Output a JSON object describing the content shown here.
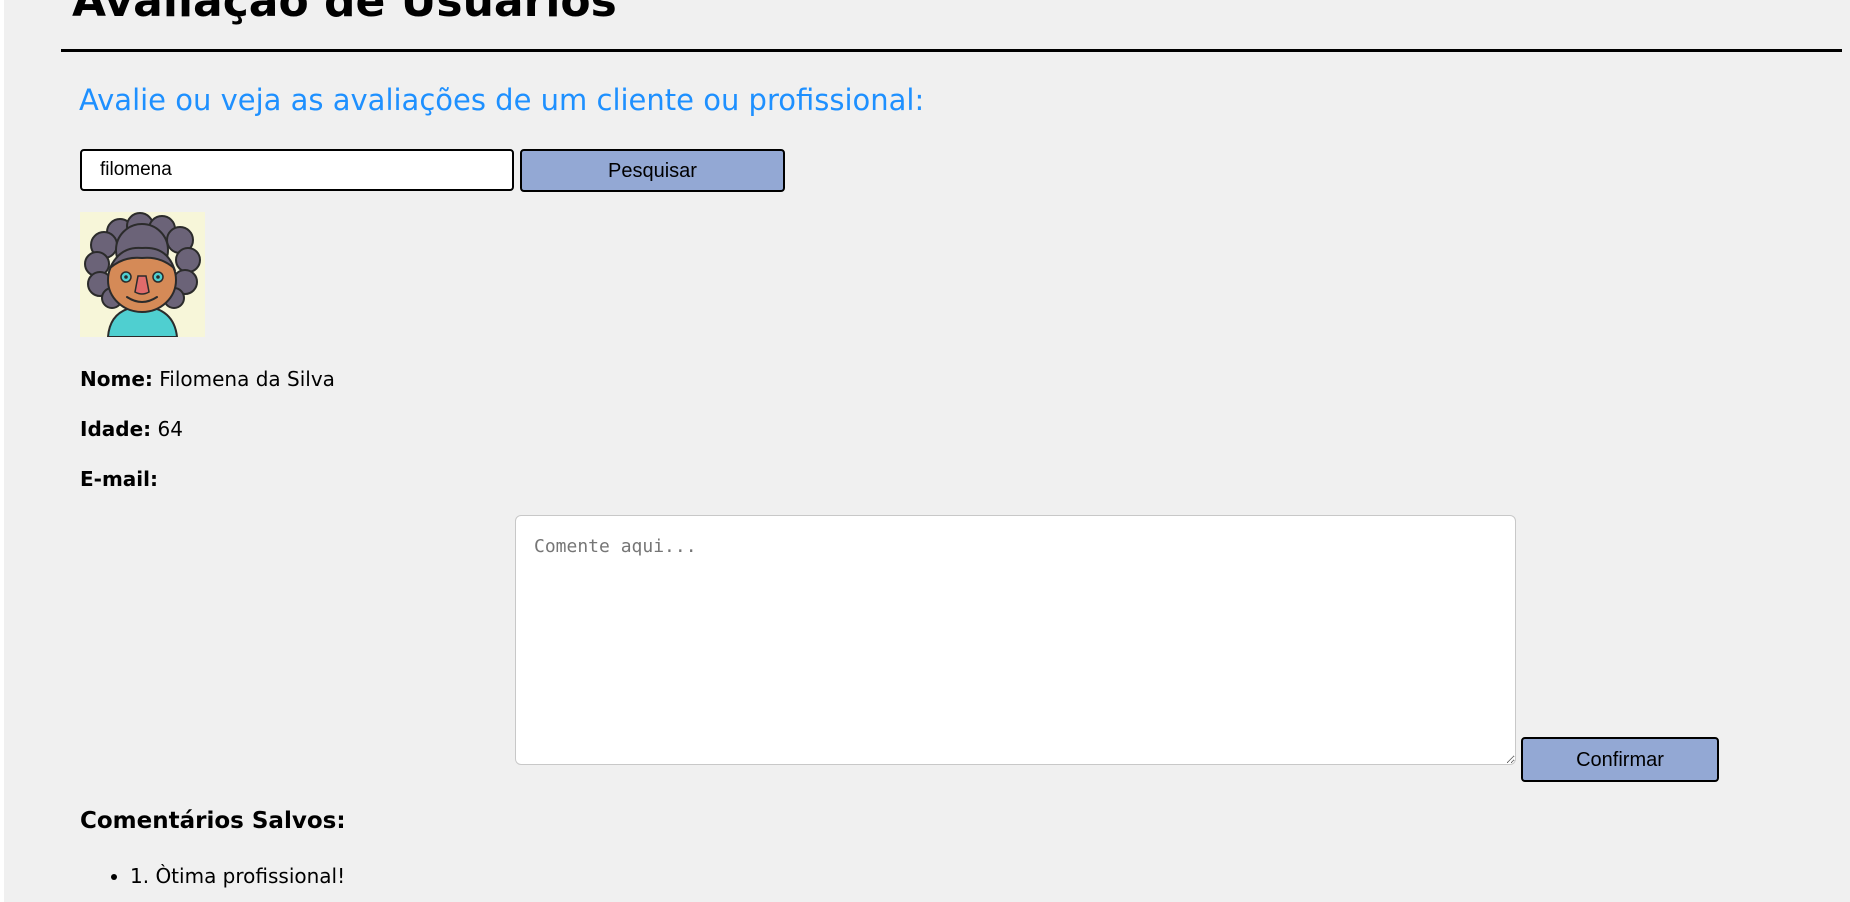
{
  "header": {
    "title": "Avaliação de Usuários"
  },
  "main": {
    "subheading": "Avalie ou veja as avaliações de um cliente ou profissional:",
    "search": {
      "value": "filomena",
      "button_label": "Pesquisar"
    },
    "profile": {
      "avatar_icon": "woman-curly-hair-avatar-icon",
      "name_label": "Nome:",
      "name_value": "Filomena da Silva",
      "age_label": "Idade:",
      "age_value": "64",
      "email_label": "E-mail:",
      "email_value": ""
    },
    "comment_form": {
      "placeholder": "Comente aqui...",
      "value": "",
      "confirm_label": "Confirmar"
    },
    "saved_comments": {
      "heading": "Comentários Salvos:",
      "items": [
        "1. Òtima profissional!"
      ]
    }
  },
  "colors": {
    "heading_accent": "#1e90ff",
    "button_bg": "#93a8d4",
    "page_bg": "#f0f0f0"
  }
}
